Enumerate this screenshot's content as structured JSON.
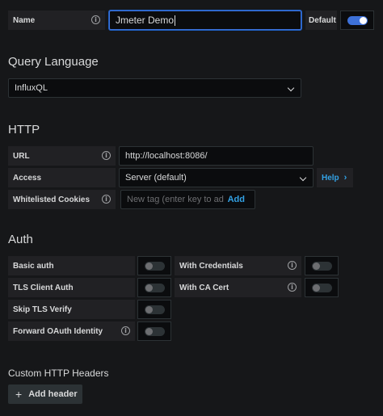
{
  "name": {
    "label": "Name",
    "value": "Jmeter Demo",
    "default_label": "Default",
    "default_on": true
  },
  "query_language": {
    "title": "Query Language",
    "selected": "InfluxQL"
  },
  "http": {
    "title": "HTTP",
    "url_label": "URL",
    "url_value": "http://localhost:8086/",
    "access_label": "Access",
    "access_value": "Server (default)",
    "help_label": "Help",
    "cookies_label": "Whitelisted Cookies",
    "cookies_placeholder": "New tag (enter key to add)",
    "cookies_add": "Add"
  },
  "auth": {
    "title": "Auth",
    "basic_auth": "Basic auth",
    "with_credentials": "With Credentials",
    "tls_client_auth": "TLS Client Auth",
    "with_ca_cert": "With CA Cert",
    "skip_tls_verify": "Skip TLS Verify",
    "forward_oauth": "Forward OAuth Identity"
  },
  "custom_headers": {
    "title": "Custom HTTP Headers",
    "add_label": "Add header"
  },
  "colors": {
    "accent": "#3d71d9",
    "link": "#33a2e5",
    "bg": "#161719"
  }
}
